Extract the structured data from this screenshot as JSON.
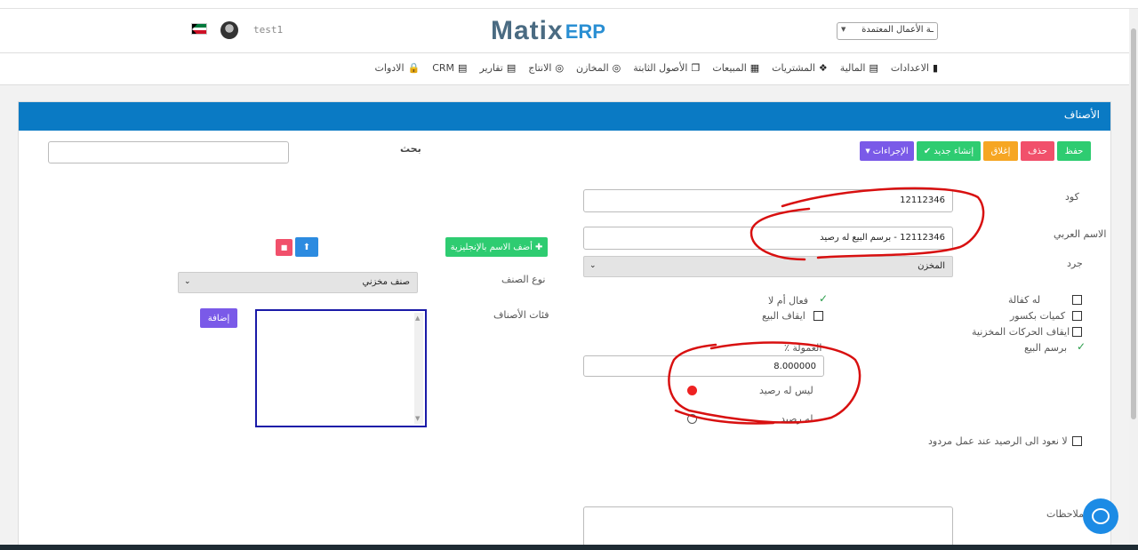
{
  "header": {
    "username": "test1",
    "logo_main": "Matix",
    "logo_suffix": "ERP",
    "company_select": "ـة الأعمال المعتمدة"
  },
  "nav": [
    {
      "label": "الاعدادات",
      "icon": "book-icon"
    },
    {
      "label": "المالية",
      "icon": "file-icon"
    },
    {
      "label": "المشتريات",
      "icon": "cubes-icon"
    },
    {
      "label": "المبيعات",
      "icon": "grid-icon"
    },
    {
      "label": "الأصول الثابتة",
      "icon": "clone-icon"
    },
    {
      "label": "المخازن",
      "icon": "bullseye-icon"
    },
    {
      "label": "الانتاج",
      "icon": "bullseye-icon"
    },
    {
      "label": "تقارير",
      "icon": "file-icon"
    },
    {
      "label": "CRM",
      "icon": "file-icon"
    },
    {
      "label": "الادوات",
      "icon": "lock-icon"
    }
  ],
  "panel": {
    "title": "الأصناف",
    "buttons": {
      "save": "حفظ",
      "delete": "حذف",
      "close": "إغلاق",
      "create_new": "إنشاء جديد",
      "actions": "الإجراءات"
    },
    "search_label": "بحث",
    "search_value": "",
    "form": {
      "code_label": "كود",
      "code_value": "12112346",
      "arabic_name_label": "الاسم العربي",
      "arabic_name_value": "12112346 - برسم البيع له رصيد",
      "inventory_label": "جرد",
      "inventory_value": "المخزن",
      "add_english_name": "أضف الاسم بالإنجليزية",
      "item_type_label": "نوع الصنف",
      "item_type_value": "صنف مخزني",
      "categories_label": "فئات الأصناف",
      "add_button": "إضافة",
      "checkboxes_right": [
        {
          "label": "له كفالة",
          "checked": false
        },
        {
          "label": "كميات بكسور",
          "checked": false
        },
        {
          "label": "ايقاف الحركات المخزنية",
          "checked": false
        },
        {
          "label": "برسم البيع",
          "checked": true
        }
      ],
      "active_label": "فعال أم لا",
      "active_checked": true,
      "stop_sale_label": "ايقاف البيع",
      "stop_sale_checked": false,
      "commission_label": "العمولة ٪",
      "commission_value": "8.000000",
      "no_balance_label": "ليس له رصيد",
      "has_balance_label": "له رصيد",
      "balance_selected": "no_balance",
      "no_return_label": "لا نعود الى الرصيد عند عمل مردود",
      "notes_label": "ملاحظات",
      "notes_value": ""
    }
  },
  "colors": {
    "panel_header": "#0a7ac4",
    "save": "#2ecc71",
    "delete": "#f1506b",
    "close": "#f6a623",
    "create_new": "#2ecc71",
    "actions": "#7a5ae8",
    "annotation": "#d81010"
  }
}
